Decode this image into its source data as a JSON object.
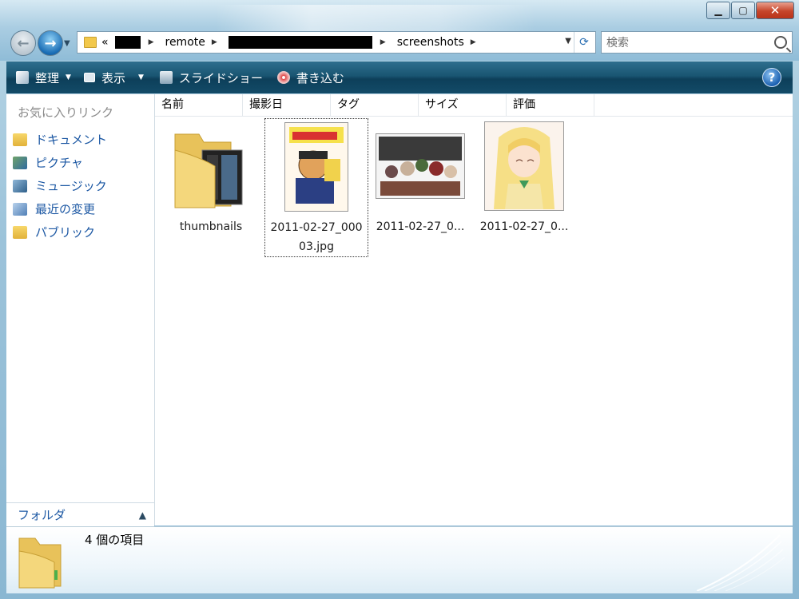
{
  "navigation": {
    "address_segments": [
      "«",
      "remote",
      "screenshots"
    ],
    "search_placeholder": "検索"
  },
  "toolbar": {
    "organize_label": "整理",
    "view_label": "表示",
    "slideshow_label": "スライドショー",
    "burn_label": "書き込む"
  },
  "sidebar": {
    "favorites_title": "お気に入りリンク",
    "items": [
      {
        "label": "ドキュメント",
        "icon": "folder-icon"
      },
      {
        "label": "ピクチャ",
        "icon": "pictures-icon"
      },
      {
        "label": "ミュージック",
        "icon": "music-icon"
      },
      {
        "label": "最近の変更",
        "icon": "recent-icon"
      },
      {
        "label": "パブリック",
        "icon": "folder-icon"
      }
    ],
    "folders_label": "フォルダ"
  },
  "columns": [
    "名前",
    "撮影日",
    "タグ",
    "サイズ",
    "評価"
  ],
  "files": [
    {
      "label": "thumbnails",
      "type": "folder"
    },
    {
      "label_line1": "2011-02-27_000",
      "label_line2": "03.jpg",
      "type": "image",
      "selected": true
    },
    {
      "label": "2011-02-27_0...",
      "type": "image"
    },
    {
      "label": "2011-02-27_0...",
      "type": "image"
    }
  ],
  "details": {
    "item_count": "4 個の項目"
  }
}
